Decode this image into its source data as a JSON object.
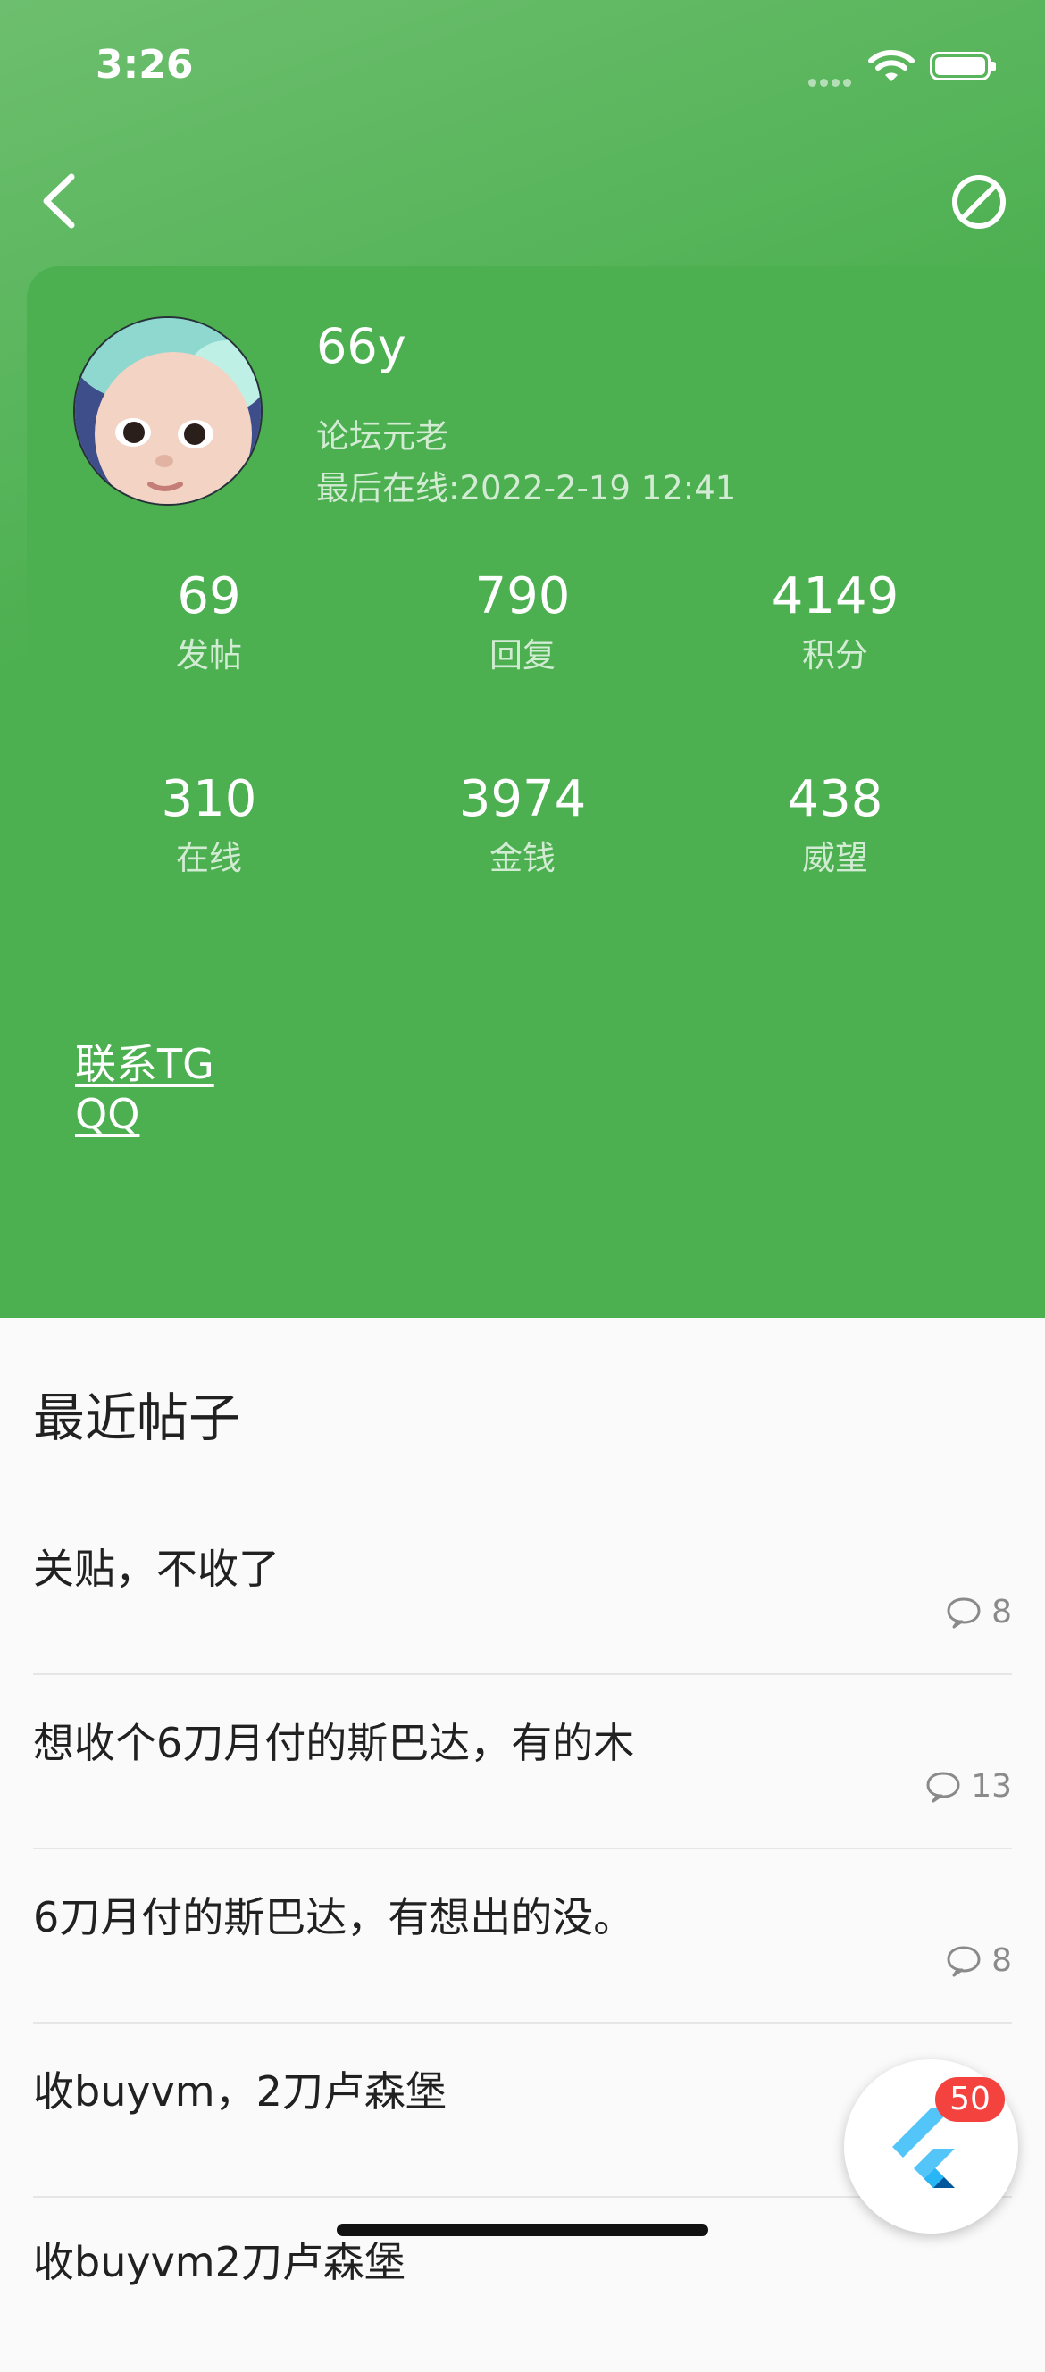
{
  "status_bar": {
    "time": "3:26"
  },
  "profile": {
    "username": "66y",
    "rank": "论坛元老",
    "last_online": "最后在线:2022-2-19 12:41",
    "stats": [
      {
        "value": "69",
        "label": "发帖"
      },
      {
        "value": "790",
        "label": "回复"
      },
      {
        "value": "4149",
        "label": "积分"
      },
      {
        "value": "310",
        "label": "在线"
      },
      {
        "value": "3974",
        "label": "金钱"
      },
      {
        "value": "438",
        "label": "威望"
      }
    ]
  },
  "contact": {
    "links": [
      "联系TG",
      "QQ"
    ]
  },
  "recent_posts": {
    "title": "最近帖子",
    "items": [
      {
        "title": "关贴，不收了",
        "replies": "8"
      },
      {
        "title": "想收个6刀月付的斯巴达，有的木",
        "replies": "13"
      },
      {
        "title": "6刀月付的斯巴达，有想出的没。",
        "replies": "8"
      },
      {
        "title": "收buyvm，2刀卢森堡",
        "replies": ""
      },
      {
        "title": "收buyvm2刀卢森堡",
        "replies": ""
      }
    ]
  },
  "fab": {
    "badge": "50"
  },
  "colors": {
    "primary": "#4caf50",
    "badge": "#f4433f"
  }
}
